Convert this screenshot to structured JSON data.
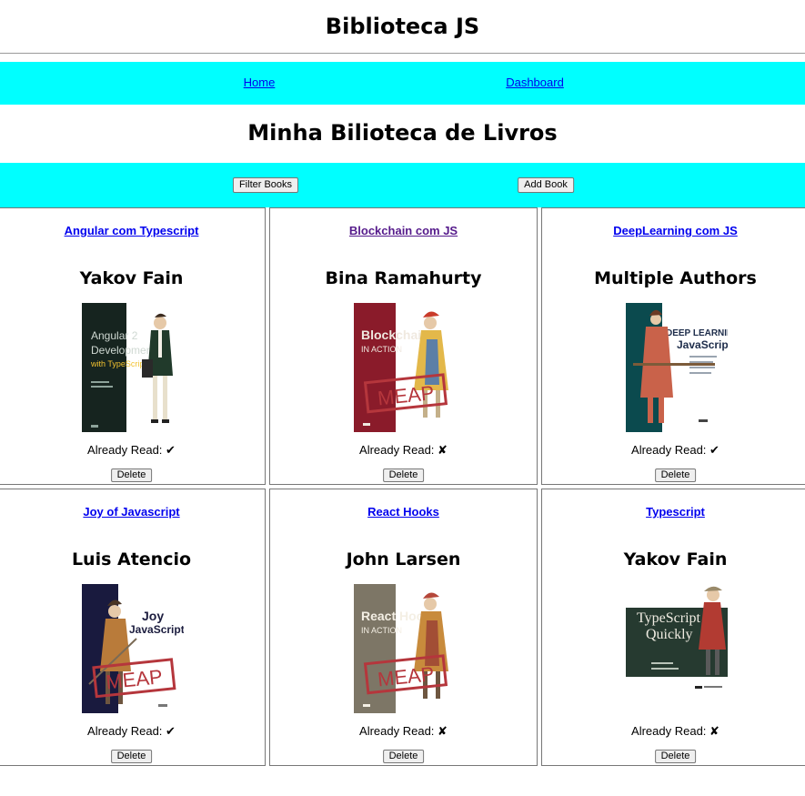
{
  "header": {
    "title": "Biblioteca JS"
  },
  "nav": {
    "home": "Home",
    "dashboard": "Dashboard"
  },
  "page": {
    "title": "Minha Bilioteca de Livros"
  },
  "actions": {
    "filter_label": "Filter Books",
    "add_label": "Add Book"
  },
  "labels": {
    "already_read": "Already Read:",
    "delete": "Delete"
  },
  "books": [
    {
      "title": "Angular com Typescript",
      "author": "Yakov Fain",
      "read_mark": "✔"
    },
    {
      "title": "Blockchain com JS",
      "author": "Bina Ramahurty",
      "read_mark": "✘"
    },
    {
      "title": "DeepLearning com JS",
      "author": "Multiple Authors",
      "read_mark": "✔"
    },
    {
      "title": "Joy of Javascript",
      "author": "Luis Atencio",
      "read_mark": "✔"
    },
    {
      "title": "React Hooks",
      "author": "John Larsen",
      "read_mark": "✘"
    },
    {
      "title": "Typescript",
      "author": "Yakov Fain",
      "read_mark": "✘"
    }
  ],
  "covers": {
    "angular": {
      "line1": "Angular 2",
      "line2": "Development",
      "line3": "with TypeScript"
    },
    "blockchain": {
      "line1": "Blockchain",
      "line2": "IN ACTION",
      "stamp": "MEAP"
    },
    "deeplearning": {
      "line1": "DEEP LEARNING",
      "line2": "JavaScript"
    },
    "joy": {
      "line1": "Joy",
      "line2": "JavaScript",
      "stamp": "MEAP"
    },
    "react": {
      "line1": "React Hooks",
      "line2": "IN ACTION",
      "stamp": "MEAP"
    },
    "typescript": {
      "line1": "TypeScript",
      "line2": "Quickly"
    }
  },
  "colors": {
    "accent_bar": "#00ffff",
    "link": "#0000ee",
    "visited_link": "#551a8b"
  }
}
